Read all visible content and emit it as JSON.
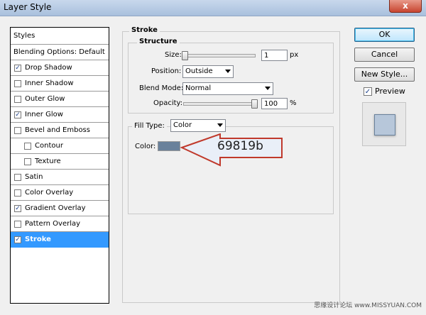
{
  "window": {
    "title": "Layer Style",
    "close_glyph": "x"
  },
  "styles_panel": {
    "header": "Styles",
    "items": [
      {
        "label": "Blending Options: Default",
        "checkbox": false,
        "checked": false,
        "indent": 0,
        "selected": false
      },
      {
        "label": "Drop Shadow",
        "checkbox": true,
        "checked": true,
        "indent": 0,
        "selected": false
      },
      {
        "label": "Inner Shadow",
        "checkbox": true,
        "checked": false,
        "indent": 0,
        "selected": false
      },
      {
        "label": "Outer Glow",
        "checkbox": true,
        "checked": false,
        "indent": 0,
        "selected": false
      },
      {
        "label": "Inner Glow",
        "checkbox": true,
        "checked": true,
        "indent": 0,
        "selected": false
      },
      {
        "label": "Bevel and Emboss",
        "checkbox": true,
        "checked": false,
        "indent": 0,
        "selected": false
      },
      {
        "label": "Contour",
        "checkbox": true,
        "checked": false,
        "indent": 1,
        "selected": false
      },
      {
        "label": "Texture",
        "checkbox": true,
        "checked": false,
        "indent": 1,
        "selected": false
      },
      {
        "label": "Satin",
        "checkbox": true,
        "checked": false,
        "indent": 0,
        "selected": false
      },
      {
        "label": "Color Overlay",
        "checkbox": true,
        "checked": false,
        "indent": 0,
        "selected": false
      },
      {
        "label": "Gradient Overlay",
        "checkbox": true,
        "checked": true,
        "indent": 0,
        "selected": false
      },
      {
        "label": "Pattern Overlay",
        "checkbox": true,
        "checked": false,
        "indent": 0,
        "selected": false
      },
      {
        "label": "Stroke",
        "checkbox": true,
        "checked": true,
        "indent": 0,
        "selected": true
      }
    ]
  },
  "stroke": {
    "section_title": "Stroke",
    "structure_title": "Structure",
    "size_label": "Size:",
    "size_value": "1",
    "size_unit": "px",
    "position_label": "Position:",
    "position_value": "Outside",
    "blend_mode_label": "Blend Mode:",
    "blend_mode_value": "Normal",
    "opacity_label": "Opacity:",
    "opacity_value": "100",
    "opacity_unit": "%",
    "fill_type_label": "Fill Type:",
    "fill_type_value": "Color",
    "color_label": "Color:",
    "color_swatch": "#69819b",
    "callout_text": "69819b"
  },
  "buttons": {
    "ok": "OK",
    "cancel": "Cancel",
    "new_style": "New Style..."
  },
  "preview": {
    "label": "Preview",
    "checked": true
  },
  "watermark": "思缘设计论坛 www.MISSYUAN.COM",
  "colors": {
    "accent_selection": "#3399ff",
    "callout_border": "#c0392b",
    "swatch": "#69819b"
  }
}
